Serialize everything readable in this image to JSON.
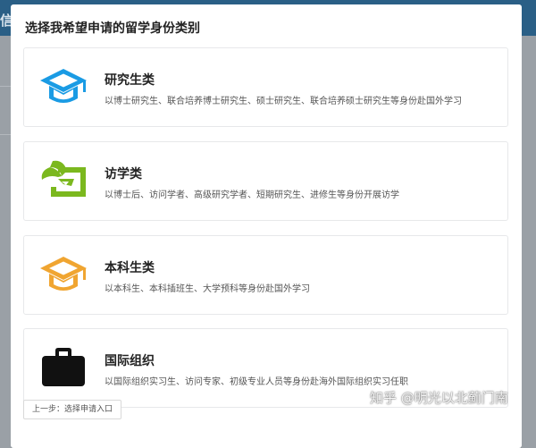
{
  "background": {
    "header_fragment": "信息"
  },
  "modal": {
    "title": "选择我希望申请的留学身份类别",
    "cards": [
      {
        "name": "研究生类",
        "description": "以博士研究生、联合培养博士研究生、硕士研究生、联合培养硕士研究生等身份赴国外学习",
        "icon": "graduation-cap-icon",
        "icon_color": "#1a9be4"
      },
      {
        "name": "访学类",
        "description": "以博士后、访问学者、高级研究学者、短期研究生、进修生等身份开展访学",
        "icon": "visiting-scholar-icon",
        "icon_color": "#7bb81e"
      },
      {
        "name": "本科生类",
        "description": "以本科生、本科插班生、大学预科等身份赴国外学习",
        "icon": "graduation-cap-icon",
        "icon_color": "#f0a531"
      },
      {
        "name": "国际组织",
        "description": "以国际组织实习生、访问专家、初级专业人员等身份赴海外国际组织实习任职",
        "icon": "briefcase-icon",
        "icon_color": "#111111"
      }
    ],
    "back_button": "上一步：选择申请入口"
  },
  "watermark": "知乎 @明光以北蓟门南"
}
